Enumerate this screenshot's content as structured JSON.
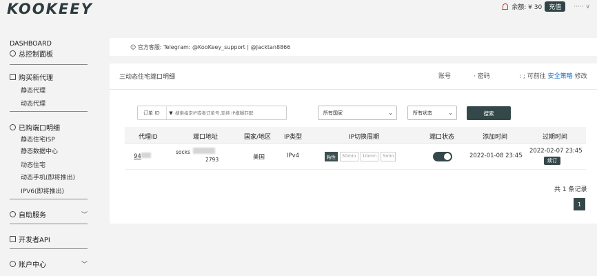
{
  "app": {
    "logo": "KOOKEEY"
  },
  "topbar": {
    "balance_label": "余额: ¥ 30",
    "recharge": "充值",
    "user": "·····  ∨"
  },
  "sidebar": {
    "dashboard_en": "DASHBOARD",
    "dashboard": "总控制面板",
    "buy": "购买新代理",
    "buy_items": [
      "静态代理",
      "动态代理"
    ],
    "purchased": "已购端口明细",
    "purchased_items": [
      "静态住宅ISP",
      "静态数据中心",
      "动态住宅",
      "动态手机(即将推出)",
      "IPV6(即将推出)"
    ],
    "self_service": "自助服务",
    "developer_api": "开发者API",
    "account": "账户中心"
  },
  "service": {
    "text": "官方客服:   Telegram: @KooKeey_support | @Jacktan8866"
  },
  "page": {
    "title": "三动态住宅端口明细",
    "account_label": "账号",
    "password_label": "· 密码",
    "goto_prefix": ": ; 可前往",
    "goto_link": "安全策略",
    "goto_suffix": "修改"
  },
  "filters": {
    "type": "订单 ID",
    "placeholder": "搜索指定IP或者订单号,支持 IP模糊匹配",
    "country": "所有国家",
    "status": "所有状态",
    "search": "搜索"
  },
  "table": {
    "headers": [
      "代理ID",
      "端口地址",
      "国家/地区",
      "IP类型",
      "IP切换周期",
      "端口状态",
      "添加时间",
      "过期时间"
    ],
    "rows": [
      {
        "id": "94",
        "addr_prefix": "socks",
        "port": "2793",
        "country": "美国",
        "ip_type": "IPv4",
        "periods": [
          "粘性",
          "30min",
          "10min",
          "5min"
        ],
        "active_period": 0,
        "port_enabled": true,
        "added": "2022-01-08 23:45",
        "expires": "2022-02-07 23:45",
        "renew": "续订"
      }
    ]
  },
  "pagination": {
    "total": "共 1 条记录",
    "current_page": "1"
  },
  "colors": {
    "accent": "#34484a",
    "link": "#1a6fc7"
  }
}
